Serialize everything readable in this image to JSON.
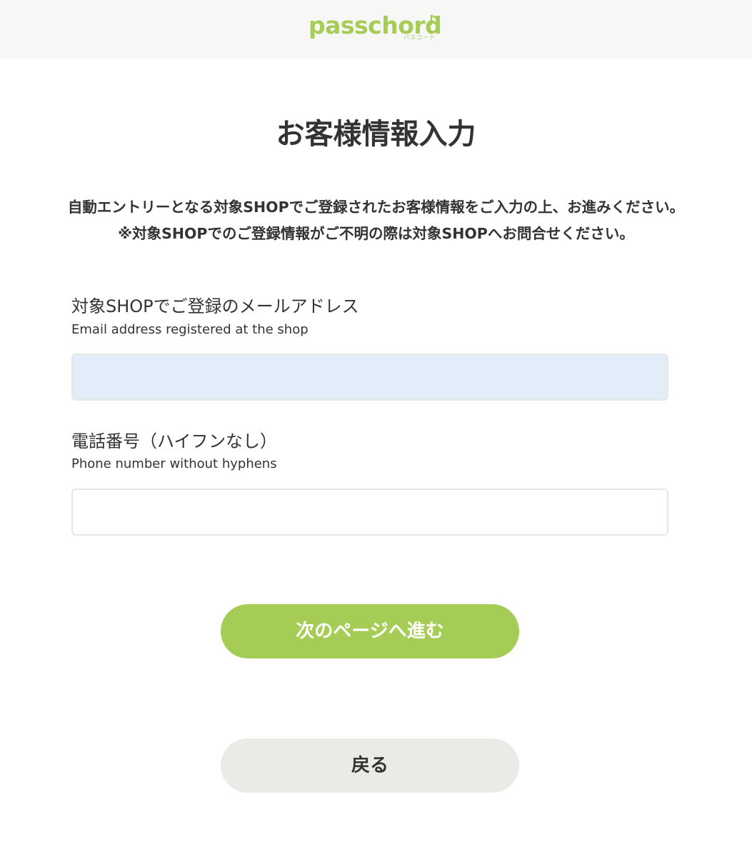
{
  "header": {
    "logo_text": "passchord",
    "logo_sub": "パスコード"
  },
  "page": {
    "title": "お客様情報入力",
    "notice_line1": "自動エントリーとなる対象SHOPでご登録されたお客様情報をご入力の上、お進みください。",
    "notice_line2": "※対象SHOPでのご登録情報がご不明の際は対象SHOPへお問合せください。"
  },
  "form": {
    "email": {
      "label": "対象SHOPでご登録のメールアドレス",
      "sublabel": "Email address registered at the shop",
      "value": "",
      "placeholder": ""
    },
    "phone": {
      "label": "電話番号（ハイフンなし）",
      "sublabel": "Phone number without hyphens",
      "value": "",
      "placeholder": ""
    }
  },
  "buttons": {
    "next_label": "次のページへ進む",
    "back_label": "戻る"
  },
  "colors": {
    "brand_green": "#a5cd55",
    "header_bg": "#f7f7f5",
    "email_field_bg": "#e3edf9",
    "back_button_bg": "#eaeae6",
    "text": "#333333"
  },
  "icons": {
    "logo_note": "music-note-icon"
  }
}
